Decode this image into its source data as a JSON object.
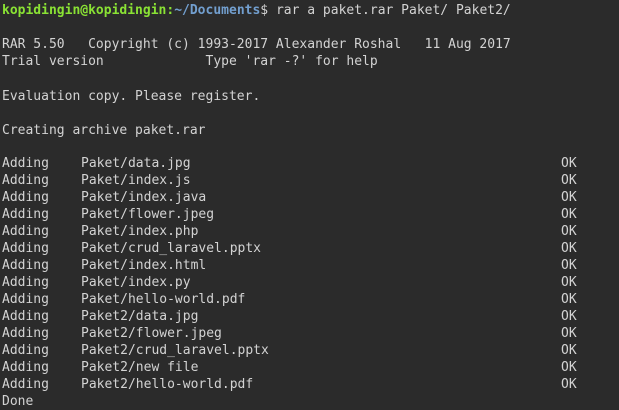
{
  "prompt": {
    "user_host": "kopidingin@kopidingin",
    "separator": ":",
    "path": "~/Documents",
    "dollar": "$",
    "command": " rar a paket.rar Paket/ Paket2/"
  },
  "header": {
    "copyright": "RAR 5.50   Copyright (c) 1993-2017 Alexander Roshal   11 Aug 2017",
    "trial": "Trial version             Type 'rar -?' for help",
    "evaluation": "Evaluation copy. Please register.",
    "creating": "Creating archive paket.rar"
  },
  "entries": [
    {
      "action": "Adding",
      "file": "Paket/data.jpg",
      "status": "OK"
    },
    {
      "action": "Adding",
      "file": "Paket/index.js",
      "status": "OK"
    },
    {
      "action": "Adding",
      "file": "Paket/index.java",
      "status": "OK"
    },
    {
      "action": "Adding",
      "file": "Paket/flower.jpeg",
      "status": "OK"
    },
    {
      "action": "Adding",
      "file": "Paket/index.php",
      "status": "OK"
    },
    {
      "action": "Adding",
      "file": "Paket/crud_laravel.pptx",
      "status": "OK"
    },
    {
      "action": "Adding",
      "file": "Paket/index.html",
      "status": "OK"
    },
    {
      "action": "Adding",
      "file": "Paket/index.py",
      "status": "OK"
    },
    {
      "action": "Adding",
      "file": "Paket/hello-world.pdf",
      "status": "OK"
    },
    {
      "action": "Adding",
      "file": "Paket2/data.jpg",
      "status": "OK"
    },
    {
      "action": "Adding",
      "file": "Paket2/flower.jpeg",
      "status": "OK"
    },
    {
      "action": "Adding",
      "file": "Paket2/crud_laravel.pptx",
      "status": "OK"
    },
    {
      "action": "Adding",
      "file": "Paket2/new file",
      "status": "OK"
    },
    {
      "action": "Adding",
      "file": "Paket2/hello-world.pdf",
      "status": "OK"
    }
  ],
  "footer": {
    "done": "Done"
  }
}
